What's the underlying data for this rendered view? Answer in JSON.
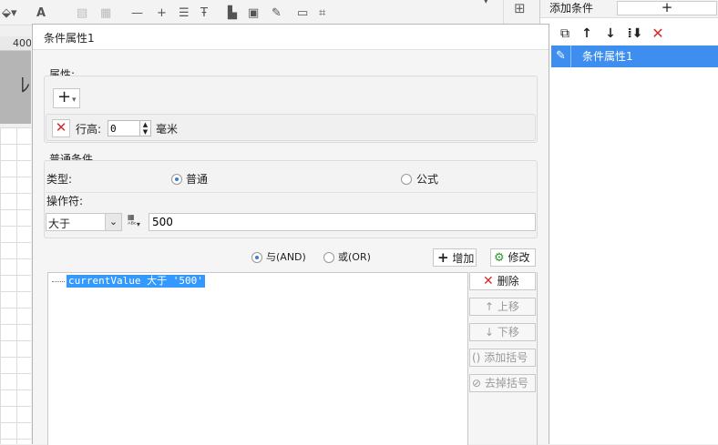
{
  "background": {
    "ruler_text": "400"
  },
  "right_panel": {
    "header_label": "添加条件",
    "add_button_symbol": "+",
    "toolbar_icons": [
      "copy-icon",
      "arrow-up-icon",
      "arrow-down-icon",
      "sort-down-icon",
      "delete-icon"
    ],
    "items": [
      {
        "label": "条件属性1",
        "selected": true
      }
    ],
    "accent": "#3e8ef0"
  },
  "dialog": {
    "title": "条件属性1",
    "properties": {
      "label": "属性:",
      "add_symbol": "+",
      "row_height": {
        "label": "行高:",
        "value": "0",
        "unit": "毫米"
      }
    },
    "normal_condition": {
      "label": "普通条件",
      "type_label": "类型:",
      "type_options": [
        {
          "label": "普通",
          "checked": true
        },
        {
          "label": "公式",
          "checked": false
        }
      ],
      "operator_label": "操作符:",
      "operator_selected": "大于",
      "value": "500"
    },
    "logic": {
      "options": [
        {
          "label": "与(AND)",
          "checked": true
        },
        {
          "label": "或(OR)",
          "checked": false
        }
      ],
      "add_label": "增加",
      "modify_label": "修改"
    },
    "tree": {
      "node_text": "currentValue 大于 '500'"
    },
    "side_buttons": {
      "delete": "删除",
      "move_up": "上移",
      "move_down": "下移",
      "add_bracket": "添加括号",
      "remove_bracket": "去掉括号"
    }
  }
}
